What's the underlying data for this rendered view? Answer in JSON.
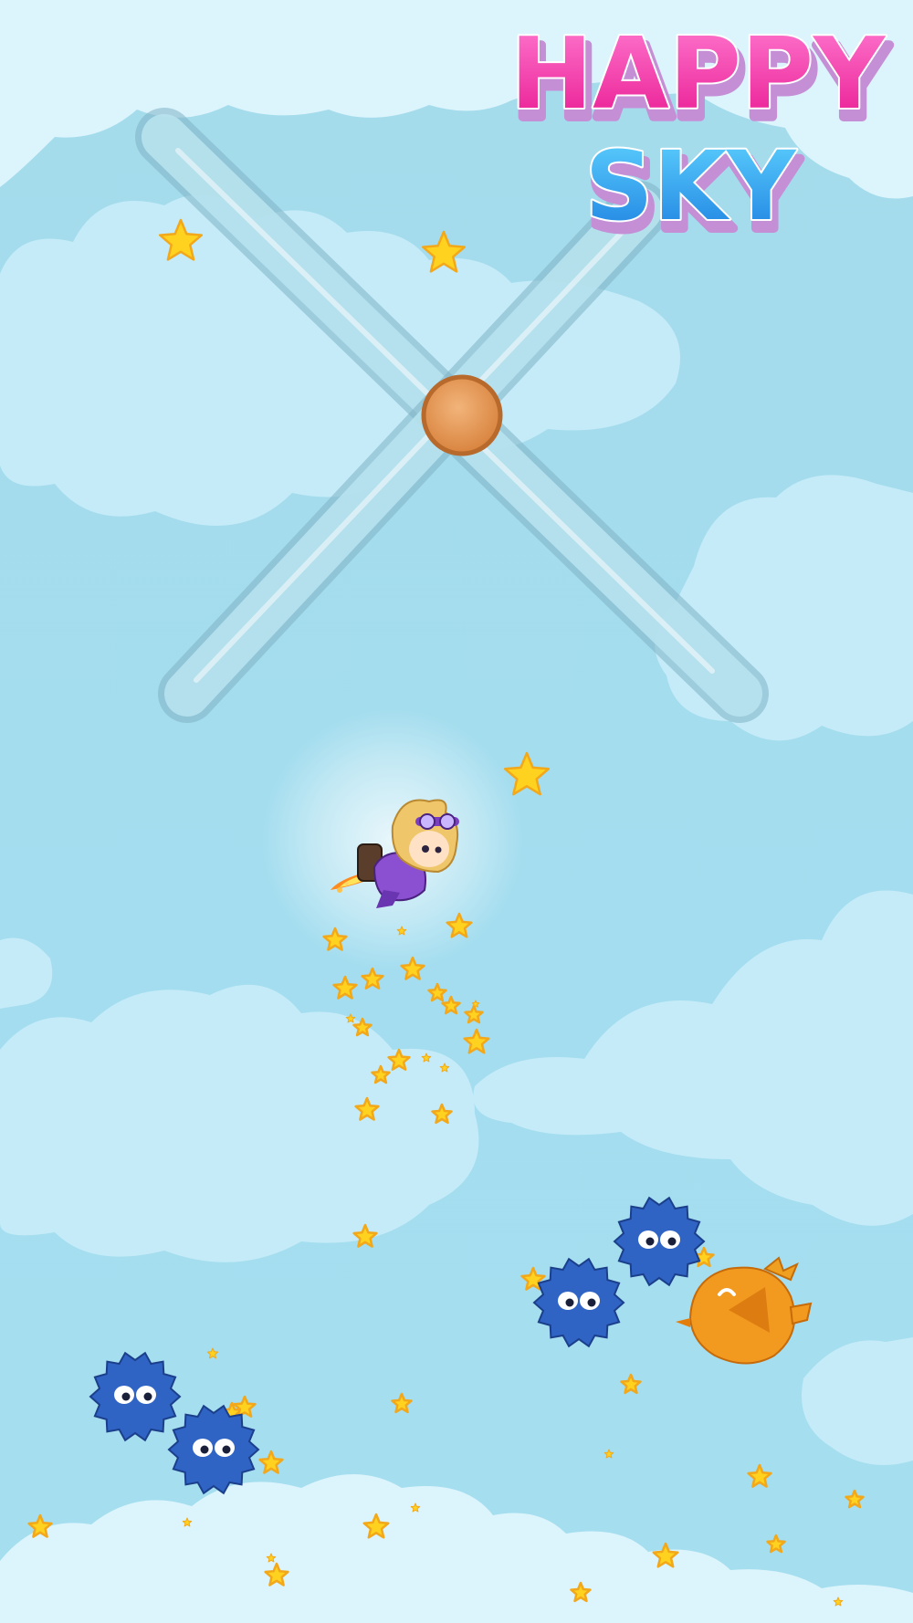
{
  "game": {
    "title_line1": "HAPPY",
    "title_line2": "SKY"
  },
  "colors": {
    "sky": "#a3dcee",
    "cloud": "#cdeef8",
    "cloud_front": "#d6f2fb",
    "propeller_blade": "#9fcfdf",
    "propeller_hub": "#e89e5c",
    "star": "#ffd21f",
    "star_outline": "#f2a81a",
    "spiky_enemy": "#2f63c4",
    "bird_enemy": "#f19a1f",
    "title_pink": "#ff3fae",
    "title_blue": "#22a6ec"
  },
  "icons": {
    "character": "jetpack-pilot-character",
    "obstacle": "spinning-propeller",
    "collectible": "star-icon",
    "enemy_spiky": "spiky-ball-enemy",
    "enemy_bird": "orange-bird-enemy"
  }
}
